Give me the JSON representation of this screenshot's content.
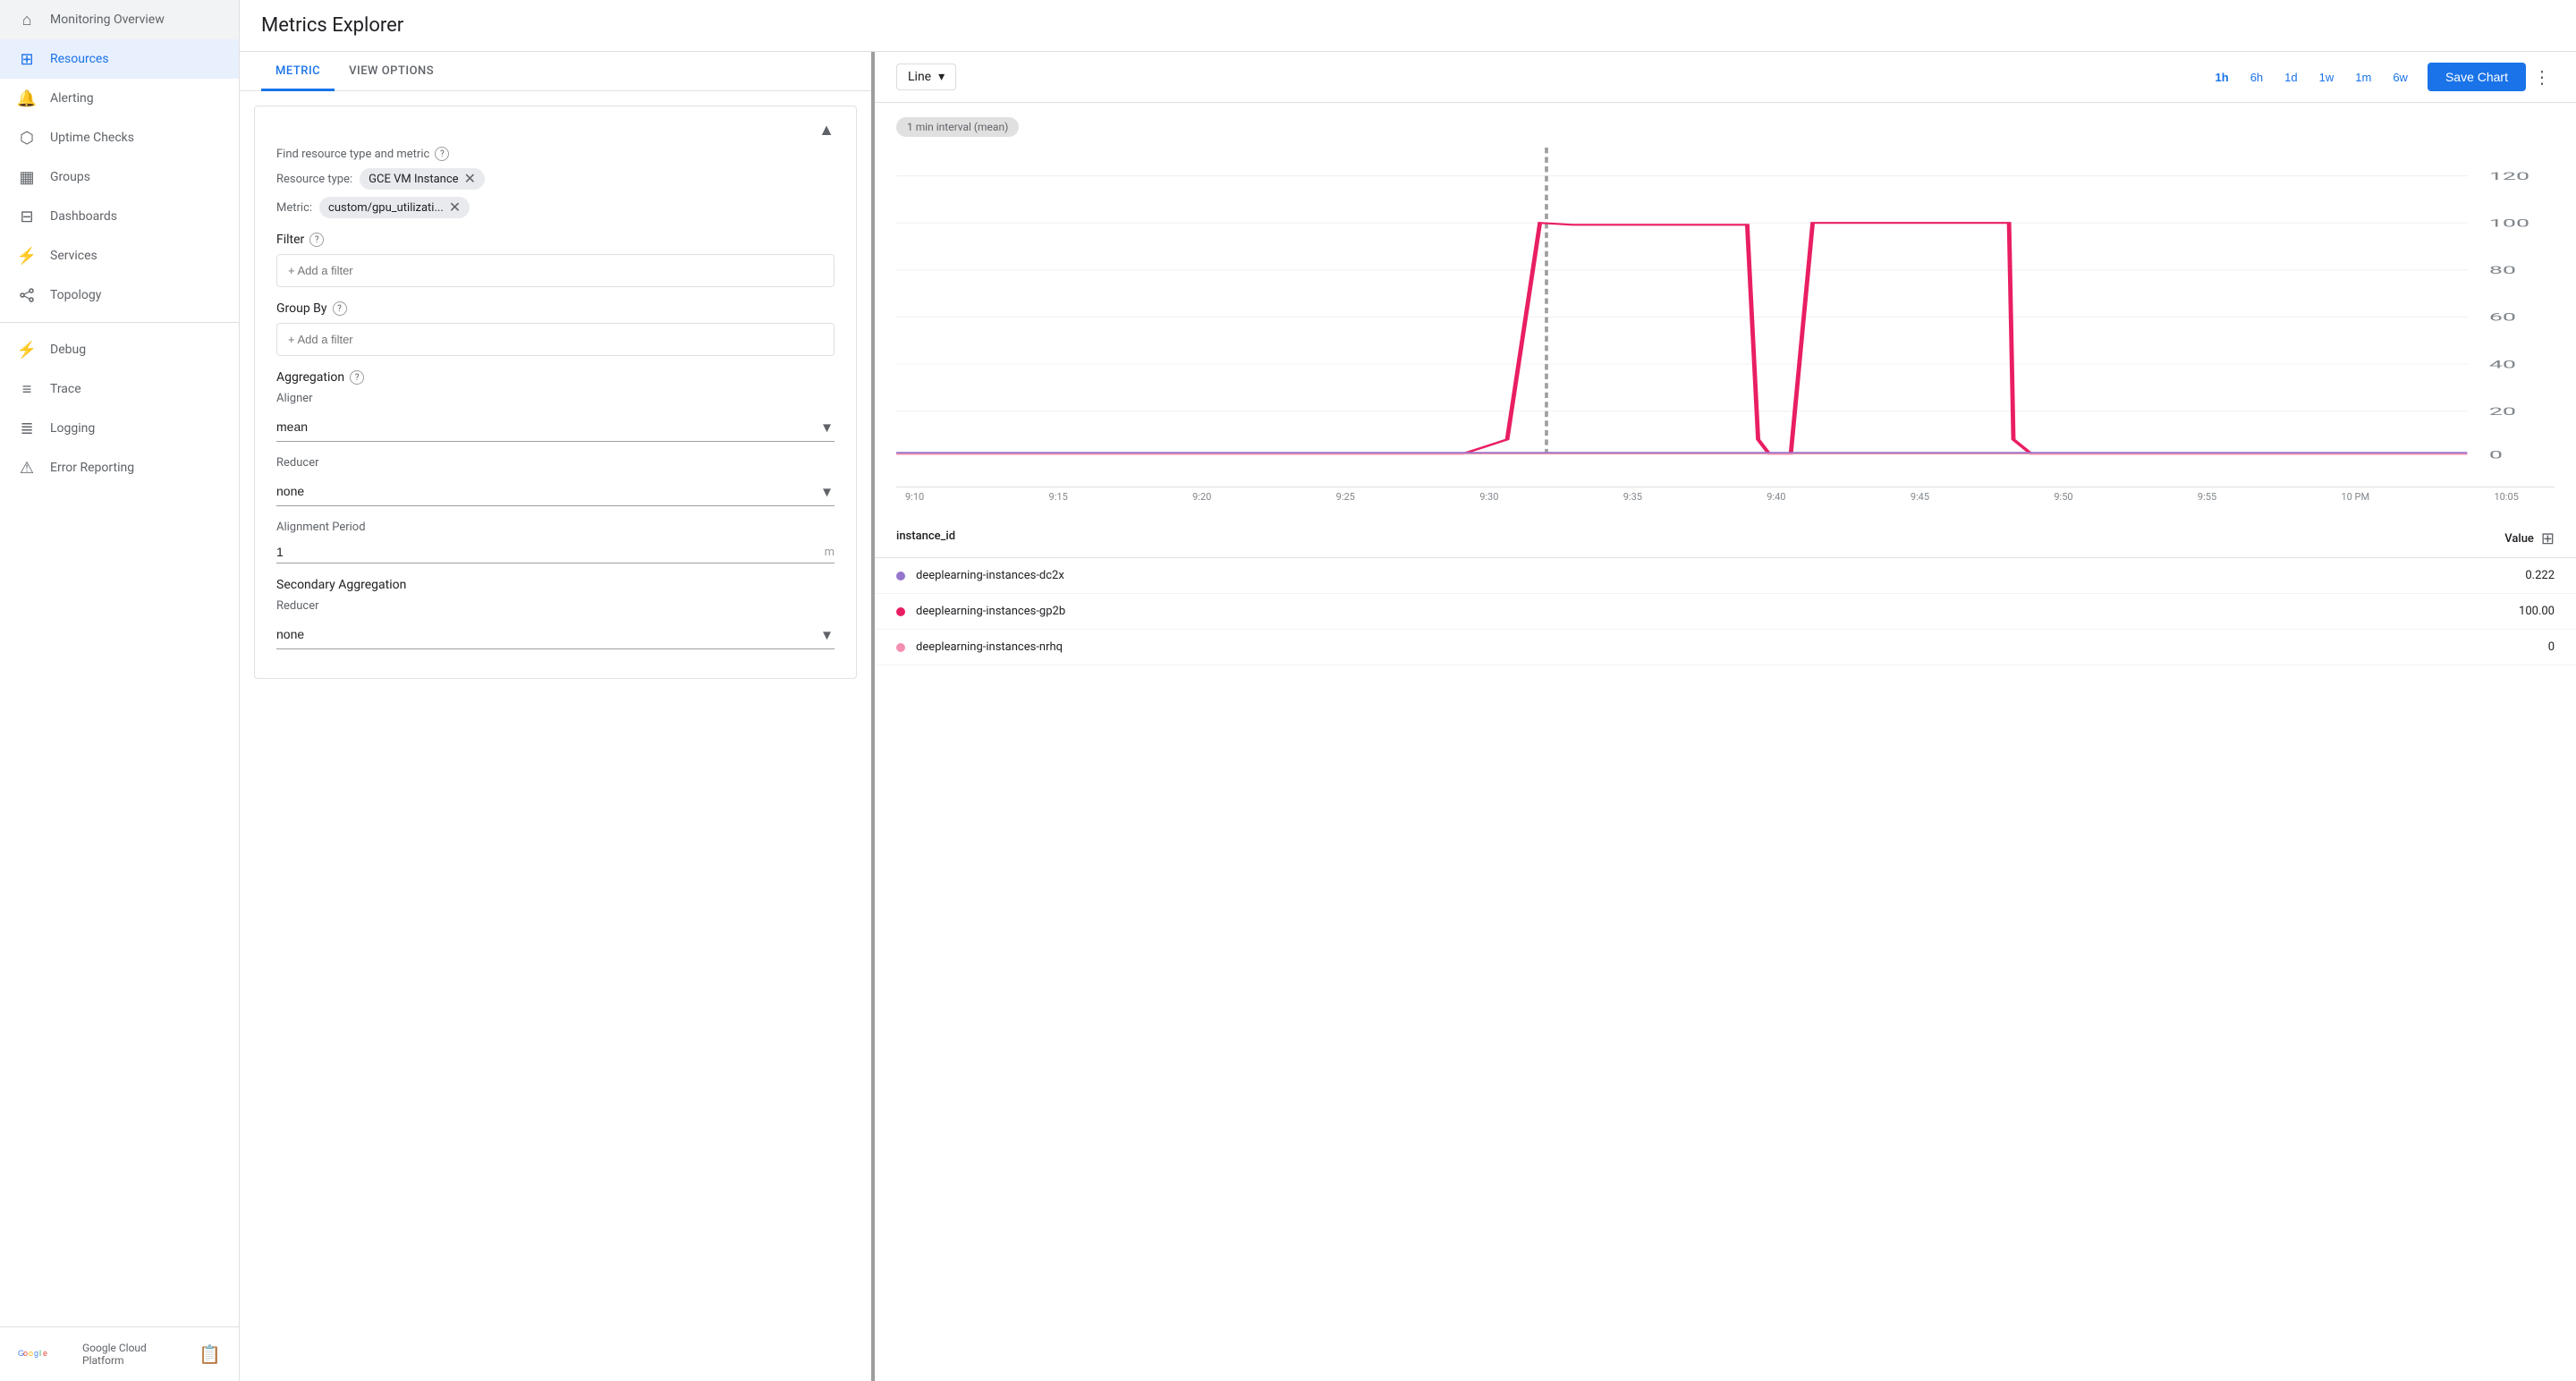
{
  "sidebar": {
    "items": [
      {
        "id": "monitoring-overview",
        "label": "Monitoring Overview",
        "icon": "⊞",
        "active": false
      },
      {
        "id": "resources",
        "label": "Resources",
        "icon": "◉",
        "active": true
      },
      {
        "id": "alerting",
        "label": "Alerting",
        "icon": "🔔",
        "active": false
      },
      {
        "id": "uptime-checks",
        "label": "Uptime Checks",
        "icon": "⬡",
        "active": false
      },
      {
        "id": "groups",
        "label": "Groups",
        "icon": "▦",
        "active": false
      },
      {
        "id": "dashboards",
        "label": "Dashboards",
        "icon": "⊟",
        "active": false
      },
      {
        "id": "services",
        "label": "Services",
        "icon": "⚡",
        "active": false
      },
      {
        "id": "topology",
        "label": "Topology",
        "icon": "⌥",
        "active": false
      },
      {
        "id": "debug",
        "label": "Debug",
        "icon": "⚡",
        "active": false
      },
      {
        "id": "trace",
        "label": "Trace",
        "icon": "≡",
        "active": false
      },
      {
        "id": "logging",
        "label": "Logging",
        "icon": "≣",
        "active": false
      },
      {
        "id": "error-reporting",
        "label": "Error Reporting",
        "icon": "⚠",
        "active": false
      }
    ],
    "footer": {
      "brand": "Google Cloud Platform",
      "icon": "📋"
    }
  },
  "page": {
    "title": "Metrics Explorer"
  },
  "tabs": {
    "metric": "METRIC",
    "view_options": "VIEW OPTIONS"
  },
  "form": {
    "find_resource_label": "Find resource type and metric",
    "resource_type_label": "Resource type:",
    "resource_type_value": "GCE VM Instance",
    "metric_label": "Metric:",
    "metric_value": "custom/gpu_utilizati...",
    "filter_label": "Filter",
    "filter_placeholder": "+ Add a filter",
    "group_by_label": "Group By",
    "group_by_placeholder": "+ Add a filter",
    "aggregation_label": "Aggregation",
    "aligner_label": "Aligner",
    "aligner_value": "mean",
    "reducer_label": "Reducer",
    "reducer_value": "none",
    "alignment_period_label": "Alignment Period",
    "alignment_period_value": "1",
    "alignment_period_unit": "m",
    "secondary_aggregation_label": "Secondary Aggregation",
    "secondary_reducer_label": "Reducer",
    "secondary_reducer_value": "none"
  },
  "chart": {
    "type": "Line",
    "interval_badge": "1 min interval (mean)",
    "time_buttons": [
      "1h",
      "6h",
      "1d",
      "1w",
      "1m",
      "6w"
    ],
    "active_time": "1h",
    "save_label": "Save Chart",
    "y_labels": [
      "120",
      "100",
      "80",
      "60",
      "40",
      "20",
      "0"
    ],
    "x_labels": [
      "9:10",
      "9:15",
      "9:20",
      "9:25",
      "9:30",
      "9:35",
      "9:40",
      "9:45",
      "9:50",
      "9:55",
      "10 PM",
      "10:05"
    ],
    "table": {
      "col1": "instance_id",
      "col2": "Value",
      "rows": [
        {
          "name": "deeplearning-instances-dc2x",
          "color": "#9575cd",
          "value": "0.222"
        },
        {
          "name": "deeplearning-instances-gp2b",
          "color": "#e91e63",
          "value": "100.00"
        },
        {
          "name": "deeplearning-instances-nrhq",
          "color": "#f48fb1",
          "value": "0"
        }
      ]
    }
  }
}
